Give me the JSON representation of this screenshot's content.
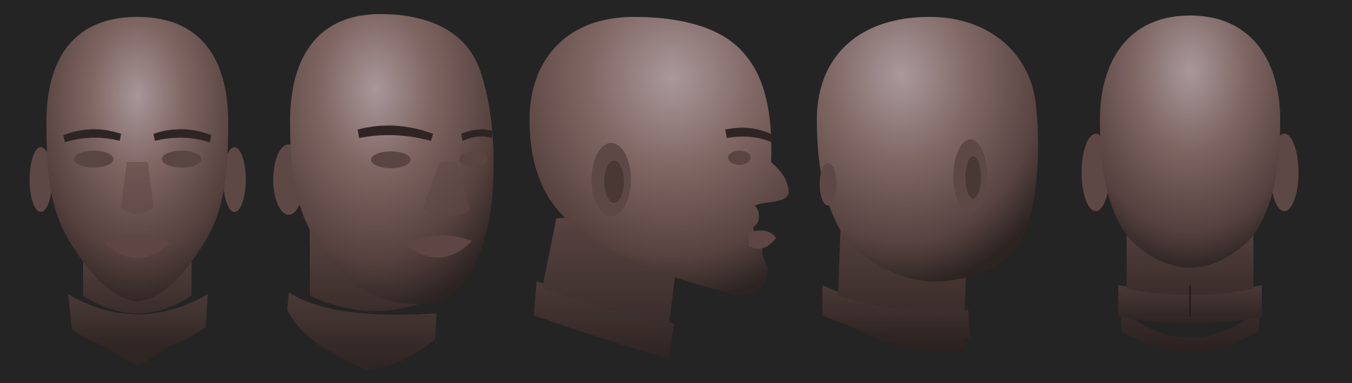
{
  "scene": {
    "background_color": "#242424",
    "clay_color": "#6e5652",
    "clay_highlight": "#a89698",
    "clay_shadow": "#2c2322",
    "views": [
      {
        "name": "front-view"
      },
      {
        "name": "three-quarter-view"
      },
      {
        "name": "profile-view"
      },
      {
        "name": "rear-three-quarter-view"
      },
      {
        "name": "back-view"
      }
    ]
  }
}
